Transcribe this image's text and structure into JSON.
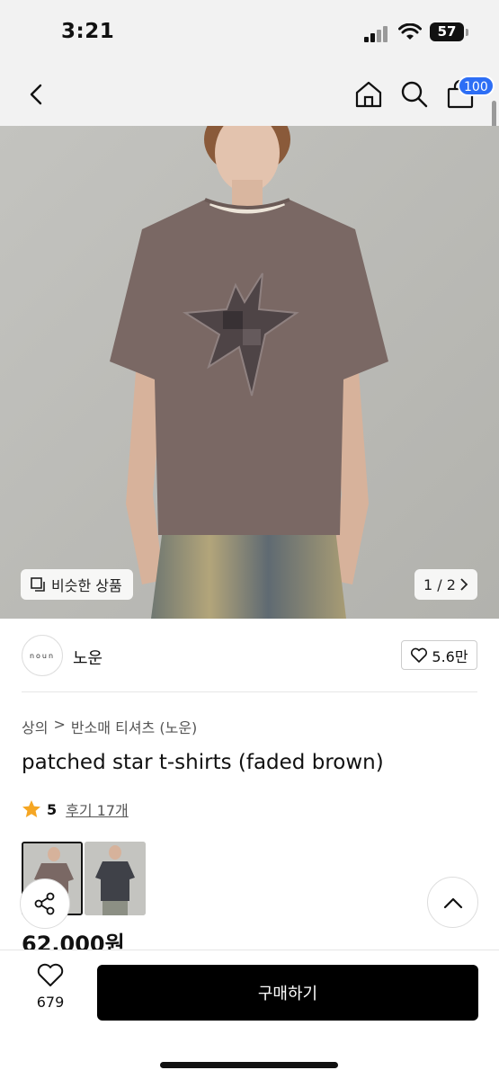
{
  "status": {
    "time": "3:21",
    "battery": "57"
  },
  "nav": {
    "back_icon": "chevron-left-icon",
    "home_icon": "home-icon",
    "search_icon": "search-icon",
    "bag_icon": "shopping-bag-icon",
    "cart_badge": "100"
  },
  "hero": {
    "similar_label": "비슷한 상품",
    "page_indicator": "1 / 2"
  },
  "brand": {
    "logo_text": "noun",
    "name": "노운",
    "likes": "5.6만"
  },
  "breadcrumb": {
    "category": "상의",
    "separator": ">",
    "subcategory": "반소매 티셔츠 (노운)"
  },
  "product": {
    "title": "patched star t-shirts (faded brown)",
    "rating": "5",
    "review_label": "후기 17개",
    "price": "62,000원"
  },
  "bottom": {
    "wish_count": "679",
    "buy_label": "구매하기"
  },
  "colors": {
    "accent": "#2d6ef5",
    "star": "#f5a623",
    "buy_button": "#000000"
  }
}
